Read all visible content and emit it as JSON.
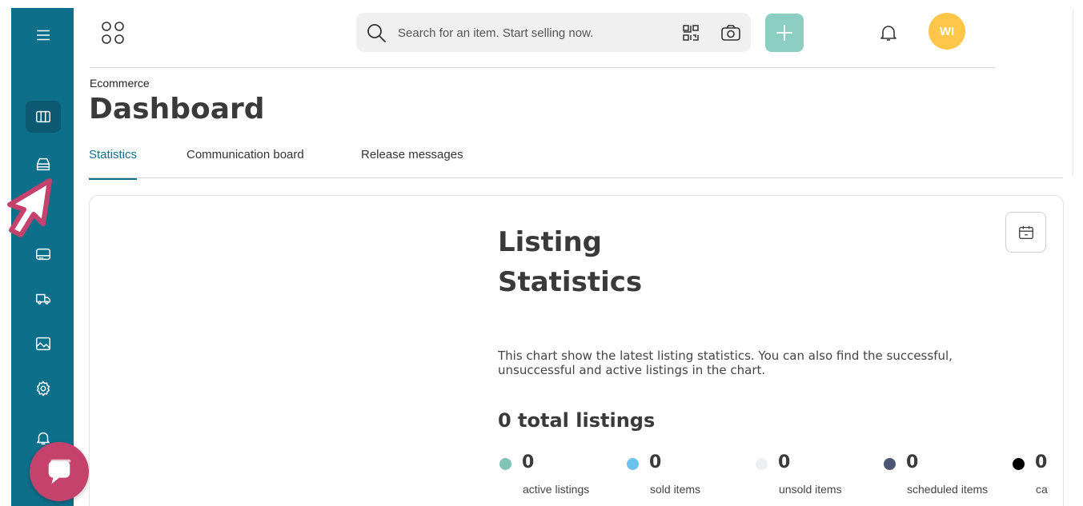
{
  "topbar": {
    "search_placeholder": "Search for an item. Start selling now.",
    "avatar_initials": "WI",
    "add_color": "#8ccfc2",
    "avatar_color": "#ffc64a"
  },
  "header": {
    "breadcrumb": "Ecommerce",
    "title": "Dashboard"
  },
  "tabs": [
    {
      "label": "Statistics",
      "active": true
    },
    {
      "label": "Communication board",
      "active": false
    },
    {
      "label": "Release messages",
      "active": false
    }
  ],
  "card": {
    "title_line1": "Listing",
    "title_line2": "Statistics",
    "description": "This chart show the latest listing statistics. You can also find the successful, unsuccessful and active listings in the chart.",
    "total": "0 total listings",
    "stats": [
      {
        "value": "0",
        "label": "active listings",
        "color": "#7fc4b5"
      },
      {
        "value": "0",
        "label": "sold items",
        "color": "#6cc2ee"
      },
      {
        "value": "0",
        "label": "unsold items",
        "color": "#eeeff2"
      },
      {
        "value": "0",
        "label": "scheduled items",
        "color": "#4a5672"
      },
      {
        "value": "0",
        "label": "ca",
        "color": "#000000"
      }
    ]
  },
  "sidebar": {
    "color": "#0e6f8b",
    "icons": [
      "menu-icon",
      "dashboard-columns-icon",
      "inventory-icon",
      "chevron-right-icon",
      "payment-card-icon",
      "shipping-truck-icon",
      "image-icon",
      "settings-gear-icon",
      "notification-bell-icon"
    ]
  }
}
